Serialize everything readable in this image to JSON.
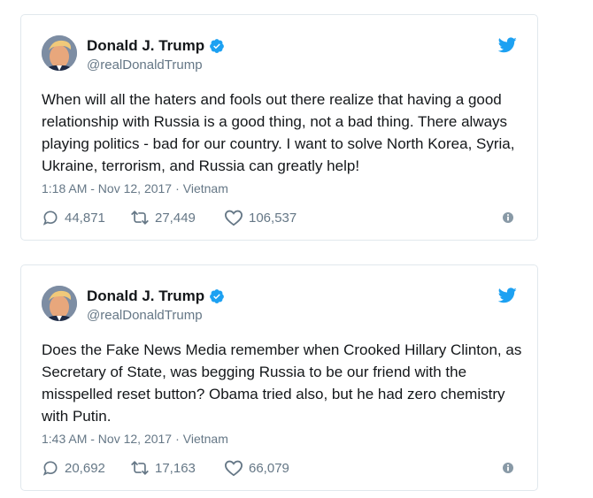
{
  "tweets": [
    {
      "display_name": "Donald J. Trump",
      "handle": "@realDonaldTrump",
      "text": "When will all the haters and fools out there realize that having a good relationship with Russia is a good thing, not a bad thing. There always playing politics - bad for our country. I want to solve North Korea, Syria, Ukraine, terrorism, and Russia can greatly help!",
      "time": "1:18 AM - Nov 12, 2017",
      "separator": "·",
      "location": "Vietnam",
      "replies": "44,871",
      "retweets": "27,449",
      "likes": "106,537"
    },
    {
      "display_name": "Donald J. Trump",
      "handle": "@realDonaldTrump",
      "text": "Does the Fake News Media remember when Crooked Hillary Clinton, as Secretary of State, was begging Russia to be our friend with the misspelled reset button? Obama tried also, but he had zero chemistry with Putin.",
      "time": "1:43 AM - Nov 12, 2017",
      "separator": "·",
      "location": "Vietnam",
      "replies": "20,692",
      "retweets": "17,163",
      "likes": "66,079"
    }
  ],
  "icons": {
    "verified": "verified-badge-icon",
    "brand": "twitter-bird-icon",
    "reply": "speech-bubble-icon",
    "retweet": "retweet-arrows-icon",
    "like": "heart-icon",
    "info": "info-circle-icon"
  },
  "colors": {
    "brand_blue": "#1da1f2",
    "text": "#14171a",
    "muted": "#657786",
    "border": "#e1e8ed"
  }
}
